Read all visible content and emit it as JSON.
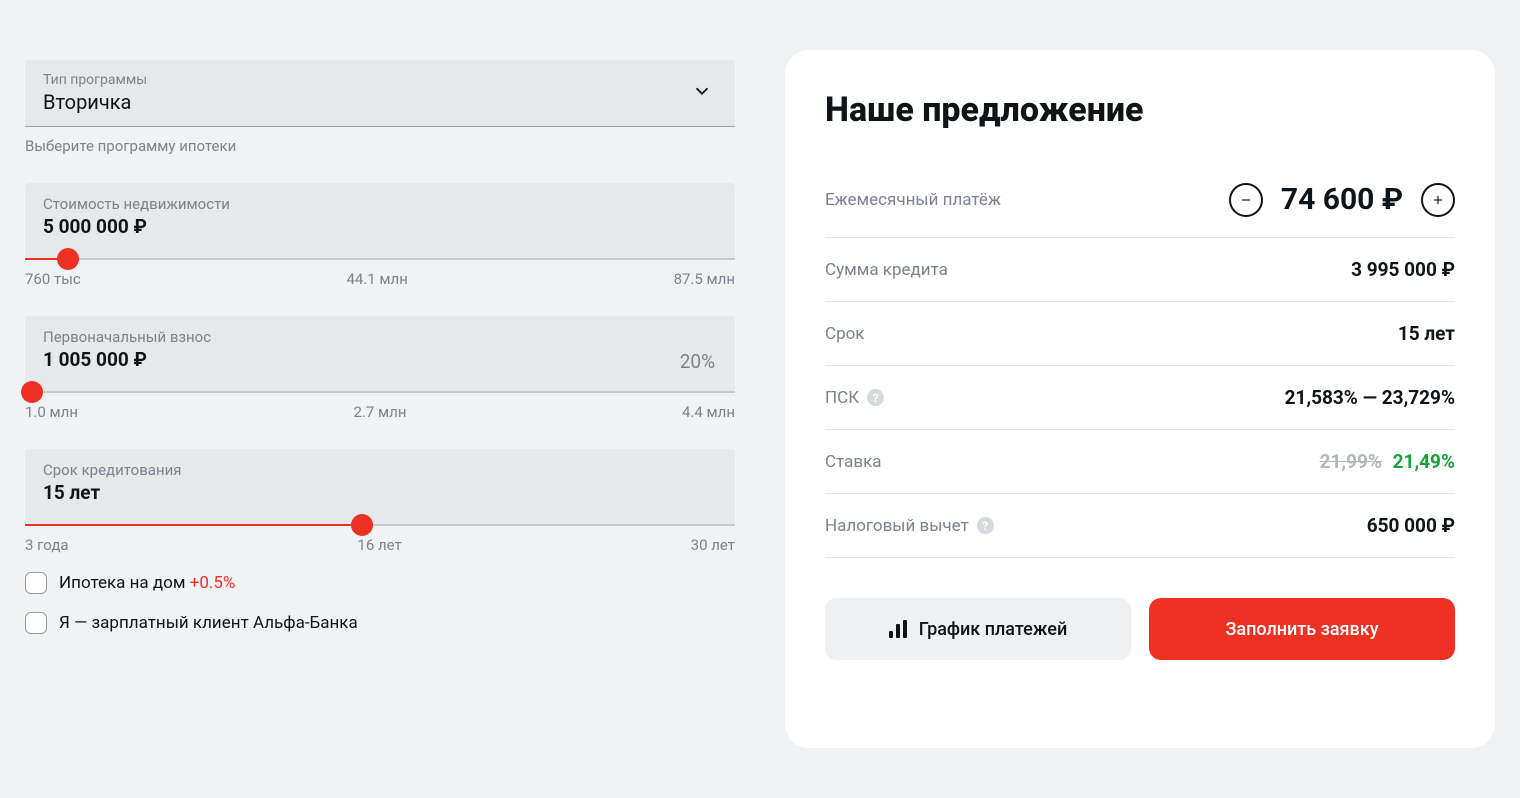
{
  "left": {
    "program": {
      "label": "Тип программы",
      "value": "Вторичка",
      "hint": "Выберите программу ипотеки"
    },
    "property": {
      "label": "Стоимость недвижимости",
      "value": "5 000 000 ₽",
      "min": "760 тыс",
      "mid": "44.1 млн",
      "max": "87.5 млн",
      "fill_percent": 6
    },
    "downpayment": {
      "label": "Первоначальный взнос",
      "value": "1 005 000 ₽",
      "percent": "20%",
      "min": "1.0 млн",
      "mid": "2.7 млн",
      "max": "4.4 млн",
      "fill_percent": 1
    },
    "term": {
      "label": "Срок кредитования",
      "value": "15 лет",
      "min": "3 года",
      "mid": "16 лет",
      "max": "30 лет",
      "fill_percent": 47.5
    },
    "cb_house": {
      "label": "Ипотека на дом",
      "addon": "+0.5%"
    },
    "cb_salary": {
      "label": "Я — зарплатный клиент Альфа-Банка"
    }
  },
  "offer": {
    "title": "Наше предложение",
    "monthly_label": "Ежемесячный платёж",
    "monthly_value": "74 600 ₽",
    "amount_label": "Сумма кредита",
    "amount_value": "3 995 000 ₽",
    "term_label": "Срок",
    "term_value": "15 лет",
    "psk_label": "ПСК",
    "psk_value": "21,583% — 23,729%",
    "rate_label": "Ставка",
    "rate_old": "21,99%",
    "rate_new": "21,49%",
    "tax_label": "Налоговый вычет",
    "tax_value": "650 000 ₽",
    "btn_schedule": "График платежей",
    "btn_apply": "Заполнить заявку"
  }
}
